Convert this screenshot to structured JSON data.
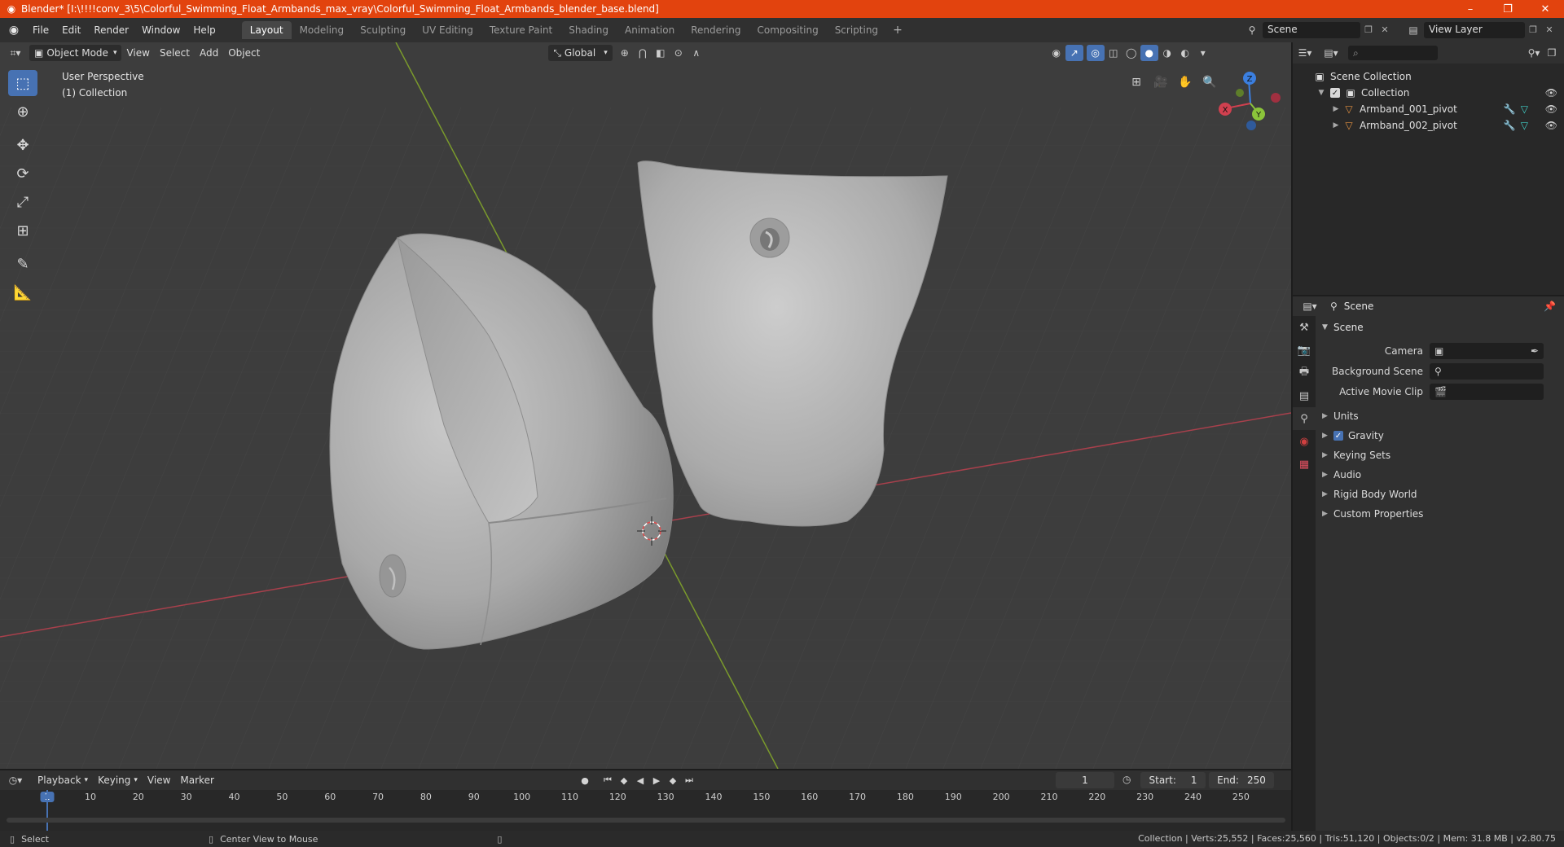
{
  "window": {
    "title": "Blender* [I:\\!!!!conv_3\\5\\Colorful_Swimming_Float_Armbands_max_vray\\Colorful_Swimming_Float_Armbands_blender_base.blend]",
    "min": "–",
    "max": "❐",
    "close": "✕"
  },
  "menu": [
    "File",
    "Edit",
    "Render",
    "Window",
    "Help"
  ],
  "workspaces": [
    "Layout",
    "Modeling",
    "Sculpting",
    "UV Editing",
    "Texture Paint",
    "Shading",
    "Animation",
    "Rendering",
    "Compositing",
    "Scripting"
  ],
  "active_workspace": "Layout",
  "scene_selector": {
    "value": "Scene"
  },
  "viewlayer_selector": {
    "value": "View Layer"
  },
  "viewport": {
    "mode": "Object Mode",
    "menus": [
      "View",
      "Select",
      "Add",
      "Object"
    ],
    "transform_orientation": "Global",
    "perspective_label": "User Perspective",
    "collection_label": "(1) Collection",
    "gizmo": {
      "x": "X",
      "y": "Y",
      "z": "Z"
    }
  },
  "outliner": {
    "scene_collection": "Scene Collection",
    "collection": "Collection",
    "objects": [
      "Armband_001_pivot",
      "Armband_002_pivot"
    ]
  },
  "properties": {
    "context_label": "Scene",
    "panel_title": "Scene",
    "camera_label": "Camera",
    "bg_scene_label": "Background Scene",
    "movie_clip_label": "Active Movie Clip",
    "subpanels": [
      "Units",
      "Gravity",
      "Keying Sets",
      "Audio",
      "Rigid Body World",
      "Custom Properties"
    ]
  },
  "timeline": {
    "menus": [
      "Playback",
      "Keying",
      "View",
      "Marker"
    ],
    "current_frame": "1",
    "start_label": "Start:",
    "start": "1",
    "end_label": "End:",
    "end": "250",
    "ticks": [
      "1",
      "10",
      "20",
      "30",
      "40",
      "50",
      "60",
      "70",
      "80",
      "90",
      "100",
      "110",
      "120",
      "130",
      "140",
      "150",
      "160",
      "170",
      "180",
      "190",
      "200",
      "210",
      "220",
      "230",
      "240",
      "250"
    ]
  },
  "statusbar": {
    "select": "Select",
    "center_view": "Center View to Mouse",
    "stats": "Collection | Verts:25,552 | Faces:25,560 | Tris:51,120 | Objects:0/2 | Mem: 31.8 MB | v2.80.75"
  },
  "colors": {
    "title_bar": "#e2430e",
    "accent": "#4772b3",
    "x_axis": "#d0404f",
    "y_axis": "#8bc43a",
    "z_axis": "#3b7fe0"
  }
}
